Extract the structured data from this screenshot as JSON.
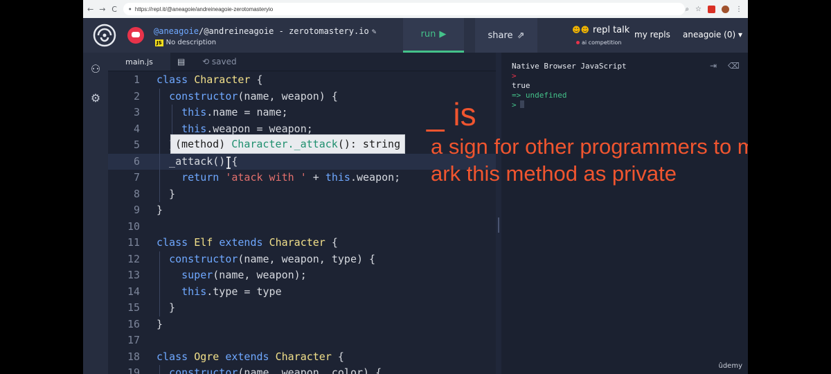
{
  "browser": {
    "url": "https://repl.it/@aneagoie/andreineagoie-zerotomasteryio",
    "nav": [
      "←",
      "→",
      "C"
    ]
  },
  "header": {
    "username": "@aneagoie",
    "slash": "/",
    "repl_name": "@andreineagoie - zerotomastery.io",
    "description": "No description",
    "lang_badge": "JS",
    "run_label": "run",
    "share_label": "share",
    "repl_talk_label": "repl talk",
    "repl_talk_sub": "ai competition",
    "my_repls_label": "my repls",
    "user_menu_label": "aneagoie (0)"
  },
  "editor": {
    "tab_label": "main.js",
    "saved_label": "saved",
    "active_line": 6,
    "tooltip": {
      "kind": "(method)",
      "name": "Character._attack",
      "signature": "(): string"
    }
  },
  "console": {
    "title": "Native Browser JavaScript",
    "lines": [
      ">",
      "true",
      "=> undefined",
      ">"
    ]
  },
  "annotation": {
    "title": "_ is",
    "text": "a sign for other programmers to m ark this method as private"
  },
  "watermark": "ûdemy",
  "colors": {
    "accent_run": "#44c28a",
    "annotation": "#f0552f",
    "keyword": "#6fa8ff",
    "class_name": "#f2e08a",
    "string": "#e3706d"
  },
  "code_lines": [
    {
      "n": "1",
      "segs": [
        {
          "t": "class ",
          "c": "kw"
        },
        {
          "t": "Character",
          "c": "cls"
        },
        {
          "t": " {",
          "c": ""
        }
      ]
    },
    {
      "n": "2",
      "segs": [
        {
          "t": "  "
        },
        {
          "t": "constructor",
          "c": "kw"
        },
        {
          "t": "(name, weapon) {"
        }
      ]
    },
    {
      "n": "3",
      "segs": [
        {
          "t": "    "
        },
        {
          "t": "this",
          "c": "kw"
        },
        {
          "t": ".name = name;"
        }
      ]
    },
    {
      "n": "4",
      "segs": [
        {
          "t": "    "
        },
        {
          "t": "this",
          "c": "kw"
        },
        {
          "t": ".weapon = weapon;"
        }
      ]
    },
    {
      "n": "5",
      "segs": [
        {
          "t": "  }"
        }
      ]
    },
    {
      "n": "6",
      "segs": [
        {
          "t": "  _attack() {"
        }
      ]
    },
    {
      "n": "7",
      "segs": [
        {
          "t": "    "
        },
        {
          "t": "return",
          "c": "kw"
        },
        {
          "t": " "
        },
        {
          "t": "'atack with '",
          "c": "str"
        },
        {
          "t": " + "
        },
        {
          "t": "this",
          "c": "kw"
        },
        {
          "t": ".weapon;"
        }
      ]
    },
    {
      "n": "8",
      "segs": [
        {
          "t": "  }"
        }
      ]
    },
    {
      "n": "9",
      "segs": [
        {
          "t": "}"
        }
      ]
    },
    {
      "n": "10",
      "segs": []
    },
    {
      "n": "11",
      "segs": [
        {
          "t": "class ",
          "c": "kw"
        },
        {
          "t": "Elf",
          "c": "cls"
        },
        {
          "t": " "
        },
        {
          "t": "extends",
          "c": "kw"
        },
        {
          "t": " "
        },
        {
          "t": "Character",
          "c": "cls"
        },
        {
          "t": " {"
        }
      ]
    },
    {
      "n": "12",
      "segs": [
        {
          "t": "  "
        },
        {
          "t": "constructor",
          "c": "kw"
        },
        {
          "t": "(name, weapon, type) {"
        }
      ]
    },
    {
      "n": "13",
      "segs": [
        {
          "t": "    "
        },
        {
          "t": "super",
          "c": "kw"
        },
        {
          "t": "(name, weapon);"
        }
      ]
    },
    {
      "n": "14",
      "segs": [
        {
          "t": "    "
        },
        {
          "t": "this",
          "c": "kw"
        },
        {
          "t": ".type = type"
        }
      ]
    },
    {
      "n": "15",
      "segs": [
        {
          "t": "  }"
        }
      ]
    },
    {
      "n": "16",
      "segs": [
        {
          "t": "}"
        }
      ]
    },
    {
      "n": "17",
      "segs": []
    },
    {
      "n": "18",
      "segs": [
        {
          "t": "class ",
          "c": "kw"
        },
        {
          "t": "Ogre",
          "c": "cls"
        },
        {
          "t": " "
        },
        {
          "t": "extends",
          "c": "kw"
        },
        {
          "t": " "
        },
        {
          "t": "Character",
          "c": "cls"
        },
        {
          "t": " {"
        }
      ]
    },
    {
      "n": "19",
      "segs": [
        {
          "t": "  "
        },
        {
          "t": "constructor",
          "c": "kw"
        },
        {
          "t": "(name, weapon, color) {"
        }
      ]
    }
  ]
}
